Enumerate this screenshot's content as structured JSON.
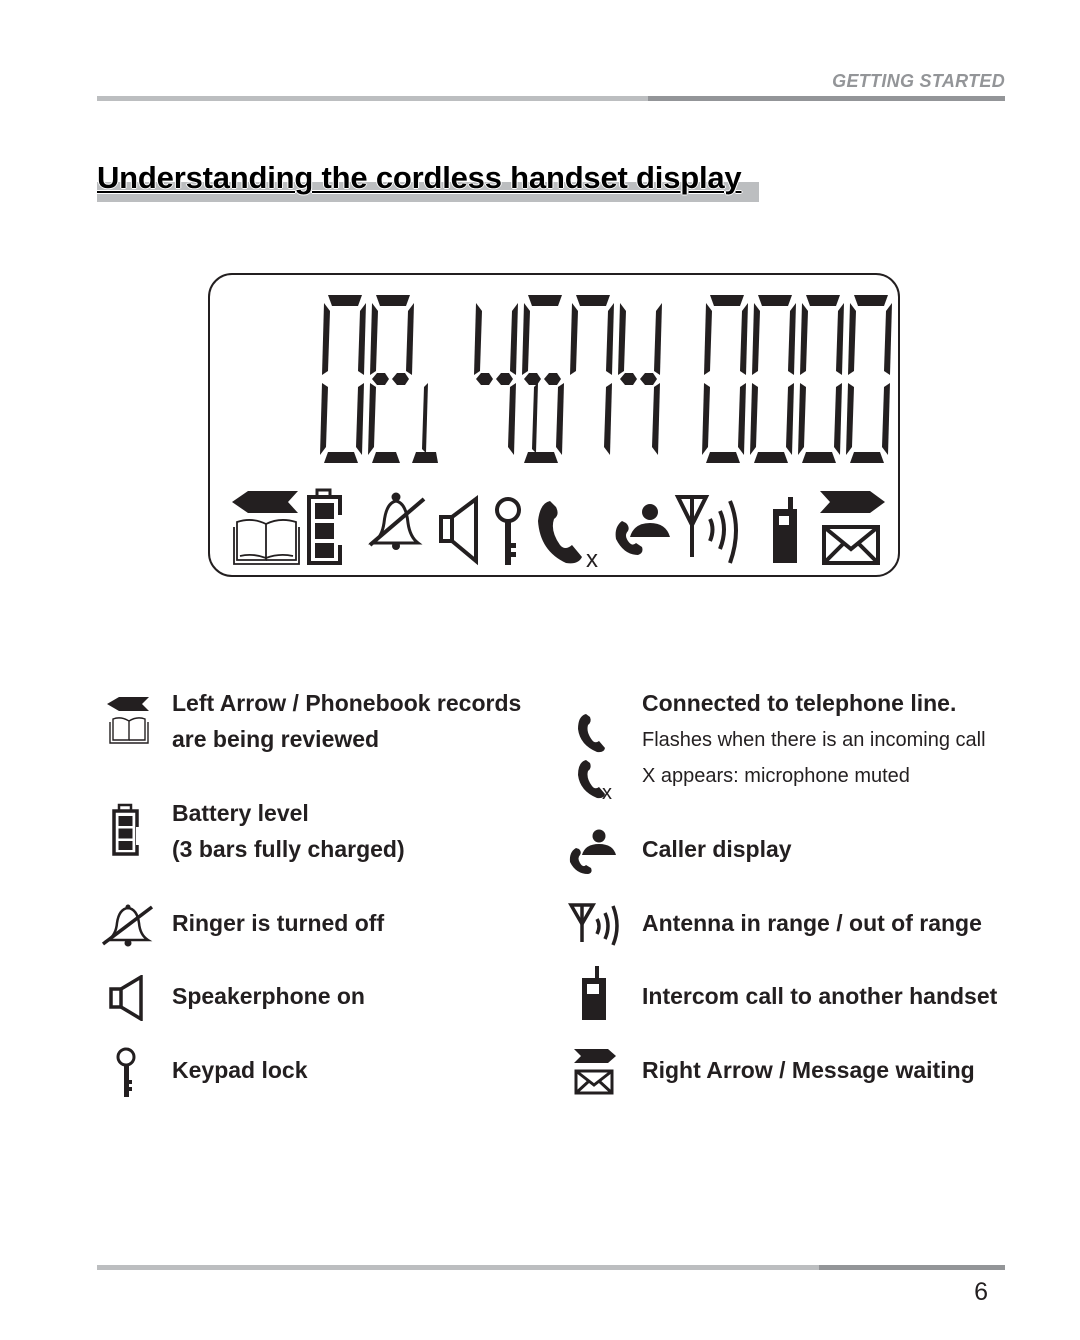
{
  "header": {
    "section": "GETTING STARTED"
  },
  "page": {
    "title": "Understanding the cordless handset display",
    "page_number": "6"
  },
  "lcd_display": {
    "digit_groups": [
      "02",
      "4574",
      "0000"
    ],
    "icons": [
      "left-arrow-icon",
      "phonebook-icon",
      "battery-icon",
      "ringer-off-icon",
      "speaker-icon",
      "key-icon",
      "handset-icon",
      "mute-x-icon",
      "caller-display-icon",
      "antenna-icon",
      "signal-waves-icon",
      "intercom-handset-icon",
      "right-arrow-icon",
      "envelope-icon"
    ],
    "mute_mark": "x"
  },
  "legend": {
    "left": [
      {
        "icon": "left-arrow-phonebook-icon",
        "lines": [
          "Left Arrow / Phonebook records",
          "are being reviewed"
        ]
      },
      {
        "icon": "battery-icon",
        "lines": [
          "Battery level",
          "(3 bars fully charged)"
        ]
      },
      {
        "icon": "ringer-off-icon",
        "lines": [
          "Ringer is turned off"
        ]
      },
      {
        "icon": "speaker-icon",
        "lines": [
          "Speakerphone on"
        ]
      },
      {
        "icon": "key-icon",
        "lines": [
          "Keypad lock"
        ]
      }
    ],
    "right": [
      {
        "icon": "handset-icon",
        "lines": [
          "Connected to telephone line."
        ],
        "sub": [
          "Flashes when there is an incoming call",
          "X appears: microphone muted"
        ]
      },
      {
        "icon": "caller-display-icon",
        "lines": [
          "Caller display"
        ]
      },
      {
        "icon": "antenna-icon",
        "lines": [
          "Antenna in range / out of range"
        ]
      },
      {
        "icon": "intercom-handset-icon",
        "lines": [
          "Intercom call to another handset"
        ]
      },
      {
        "icon": "right-arrow-envelope-icon",
        "lines": [
          "Right Arrow / Message waiting"
        ]
      }
    ],
    "mute_mark": "x"
  }
}
